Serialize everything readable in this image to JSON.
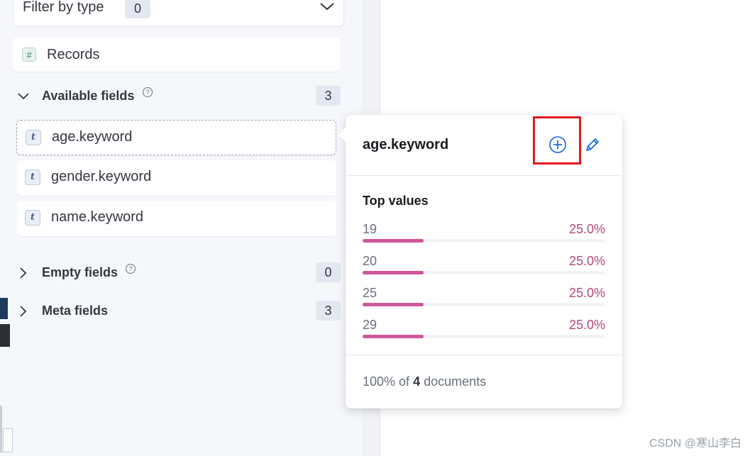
{
  "filter": {
    "label": "Filter by type",
    "count": "0"
  },
  "records": {
    "icon": "#",
    "label": "Records"
  },
  "sections": {
    "available": {
      "label": "Available fields",
      "count": "3"
    },
    "empty": {
      "label": "Empty fields",
      "count": "0"
    },
    "meta": {
      "label": "Meta fields",
      "count": "3"
    }
  },
  "fields": [
    {
      "type_icon": "t",
      "label": "age.keyword"
    },
    {
      "type_icon": "t",
      "label": "gender.keyword"
    },
    {
      "type_icon": "t",
      "label": "name.keyword"
    }
  ],
  "help_glyph": "?",
  "popover": {
    "title": "age.keyword",
    "top_values_title": "Top values",
    "values": [
      {
        "label": "19",
        "percent": "25.0%",
        "fraction": 0.25
      },
      {
        "label": "20",
        "percent": "25.0%",
        "fraction": 0.25
      },
      {
        "label": "25",
        "percent": "25.0%",
        "fraction": 0.25
      },
      {
        "label": "29",
        "percent": "25.0%",
        "fraction": 0.25
      }
    ],
    "footer_prefix": "100% of",
    "footer_count": "4",
    "footer_suffix": "documents"
  },
  "colors": {
    "bar_fill": "#cf5797",
    "percent_text": "#b3477a",
    "highlight_border": "#e3191e"
  },
  "watermark": "CSDN @寒山李白"
}
